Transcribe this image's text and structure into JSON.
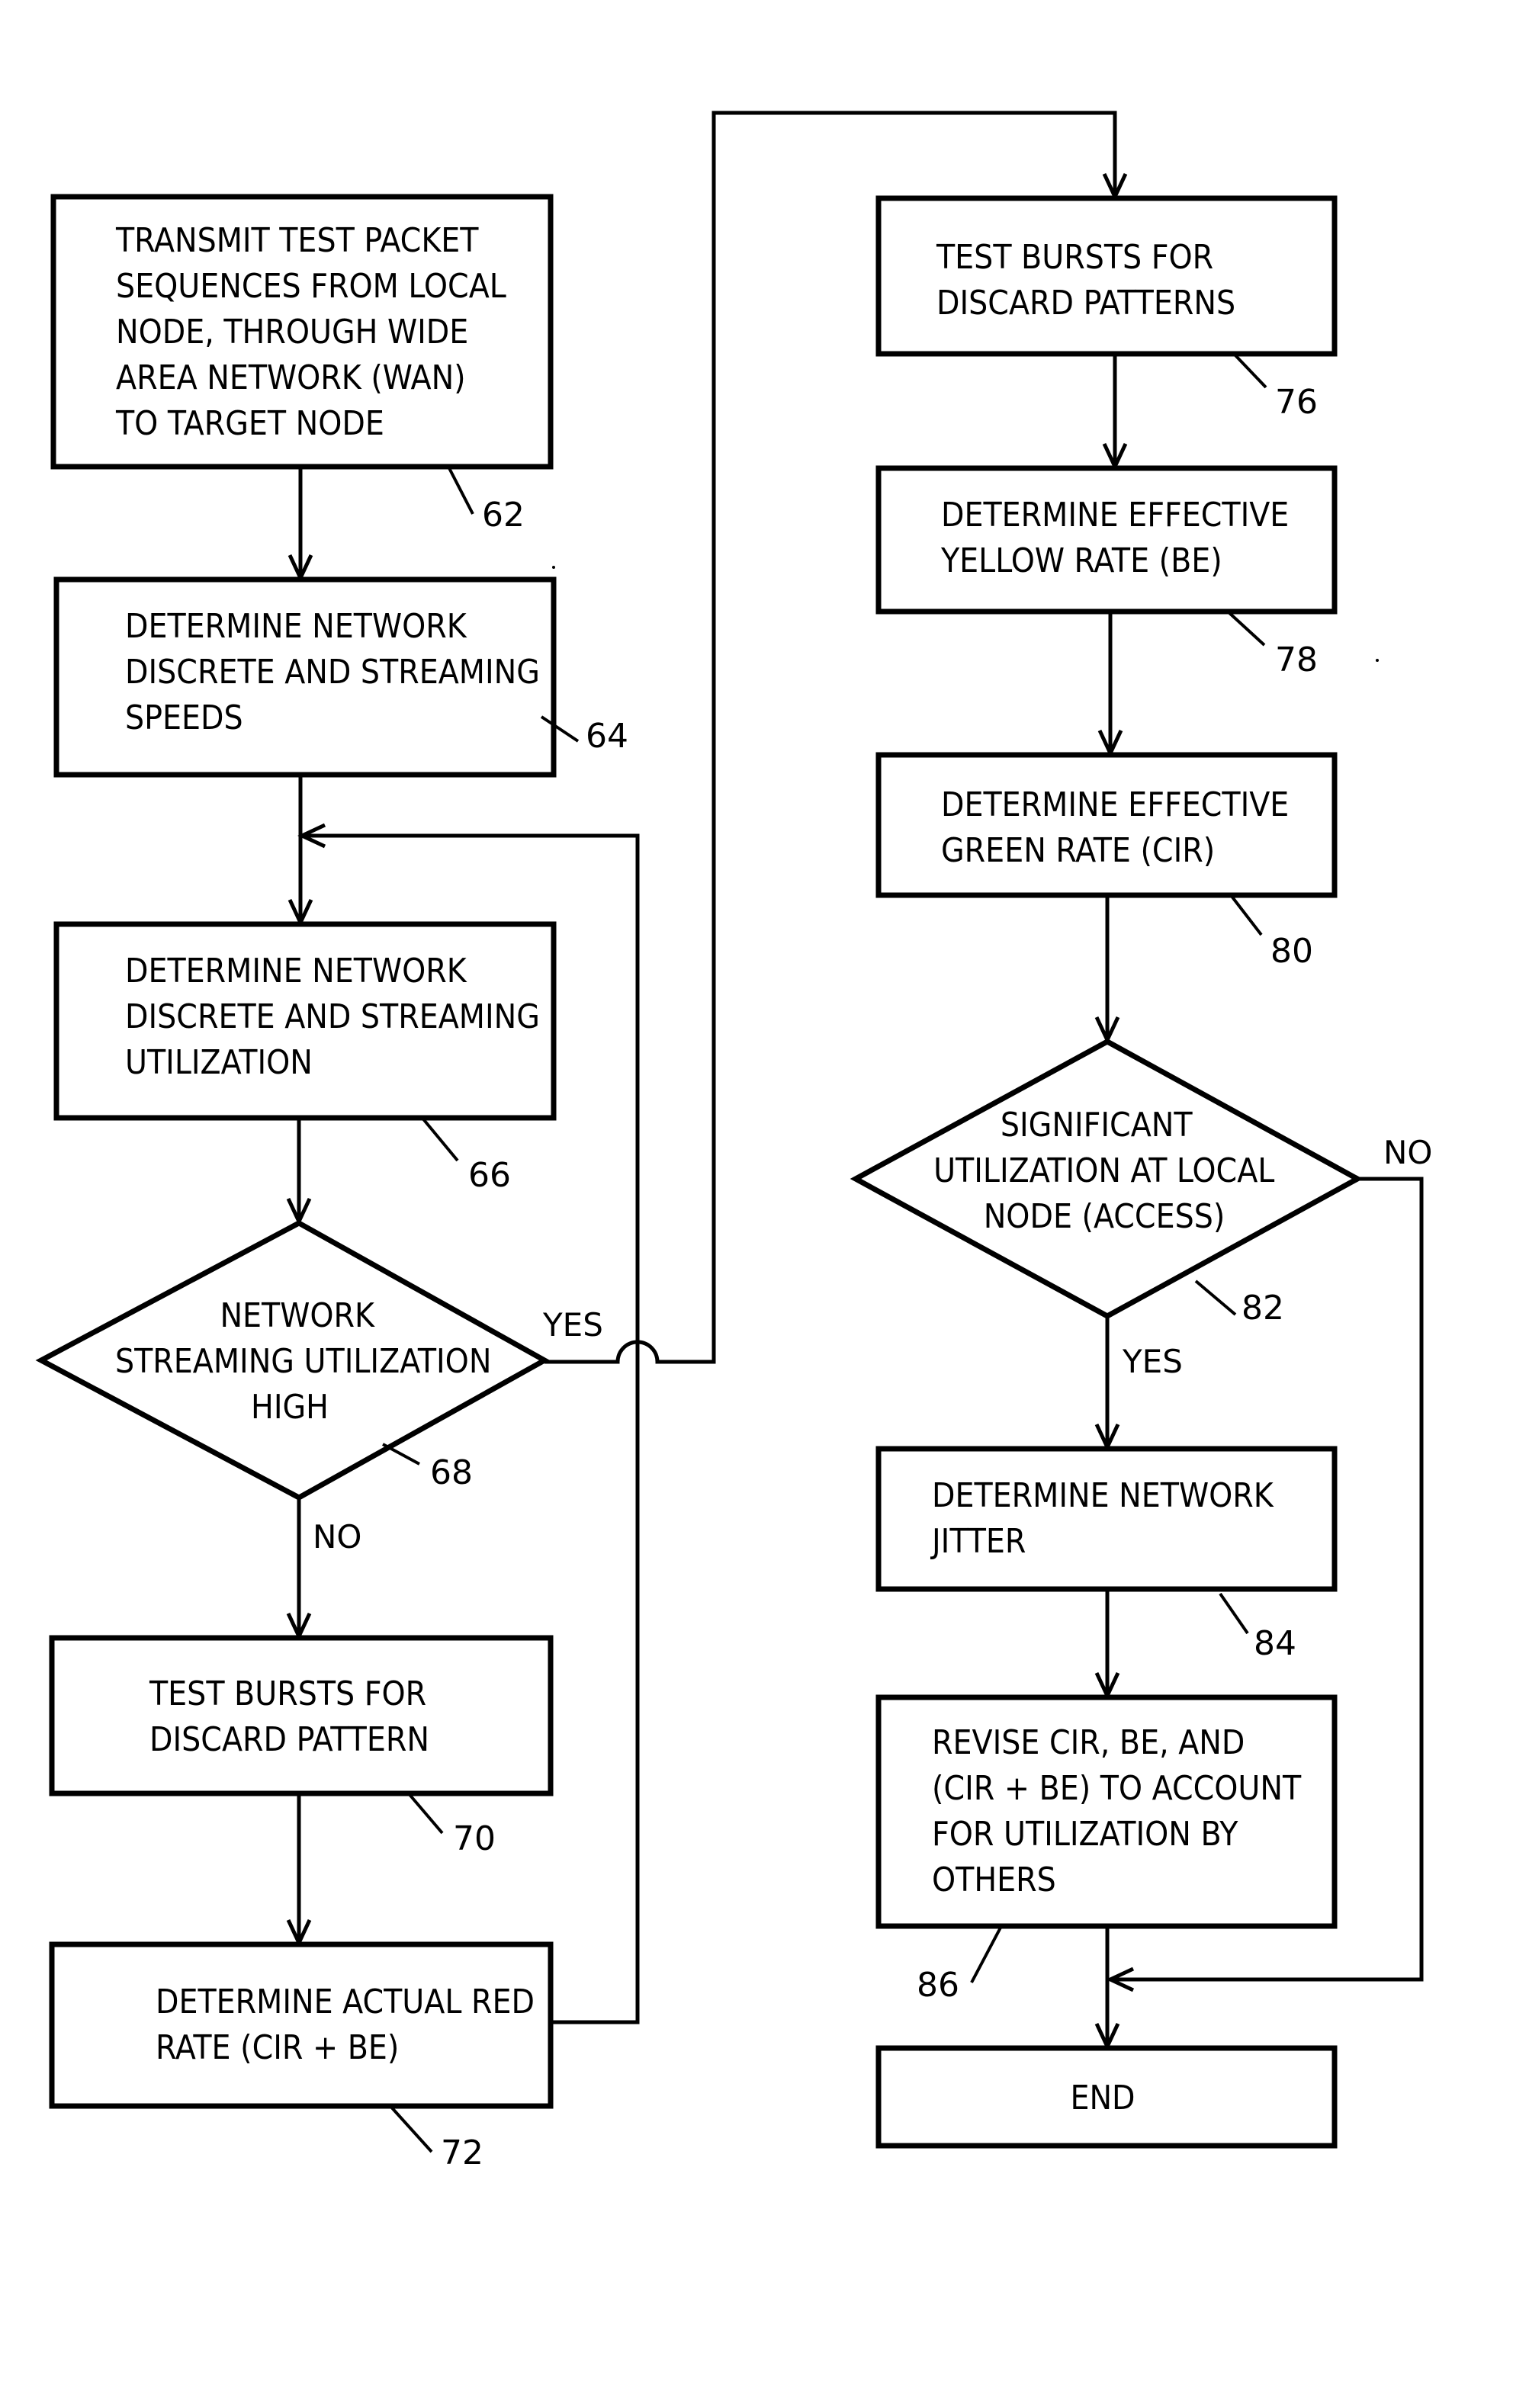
{
  "figure": {
    "type": "flowchart",
    "nodes": [
      {
        "id": "62",
        "shape": "process",
        "lines": [
          "TRANSMIT TEST PACKET",
          "SEQUENCES FROM LOCAL",
          "NODE, THROUGH WIDE",
          "AREA NETWORK (WAN)",
          "TO TARGET NODE"
        ],
        "ref": "62"
      },
      {
        "id": "64",
        "shape": "process",
        "lines": [
          "DETERMINE NETWORK",
          "DISCRETE AND STREAMING",
          "SPEEDS"
        ],
        "ref": "64"
      },
      {
        "id": "66",
        "shape": "process",
        "lines": [
          "DETERMINE NETWORK",
          "DISCRETE AND STREAMING",
          "UTILIZATION"
        ],
        "ref": "66"
      },
      {
        "id": "68",
        "shape": "decision",
        "lines": [
          "NETWORK",
          "STREAMING UTILIZATION",
          "HIGH"
        ],
        "ref": "68"
      },
      {
        "id": "70",
        "shape": "process",
        "lines": [
          "TEST BURSTS FOR",
          "DISCARD PATTERN"
        ],
        "ref": "70"
      },
      {
        "id": "72",
        "shape": "process",
        "lines": [
          "DETERMINE ACTUAL RED",
          "RATE (CIR + BE)"
        ],
        "ref": "72"
      },
      {
        "id": "76",
        "shape": "process",
        "lines": [
          "TEST BURSTS FOR",
          "DISCARD PATTERNS"
        ],
        "ref": "76"
      },
      {
        "id": "78",
        "shape": "process",
        "lines": [
          "DETERMINE EFFECTIVE",
          "YELLOW RATE (BE)"
        ],
        "ref": "78"
      },
      {
        "id": "80",
        "shape": "process",
        "lines": [
          "DETERMINE EFFECTIVE",
          "GREEN RATE (CIR)"
        ],
        "ref": "80"
      },
      {
        "id": "82",
        "shape": "decision",
        "lines": [
          "SIGNIFICANT",
          "UTILIZATION AT LOCAL",
          "NODE (ACCESS)"
        ],
        "ref": "82"
      },
      {
        "id": "84",
        "shape": "process",
        "lines": [
          "DETERMINE NETWORK",
          "JITTER"
        ],
        "ref": "84"
      },
      {
        "id": "86",
        "shape": "process",
        "lines": [
          "REVISE CIR, BE, AND",
          "(CIR + BE) TO ACCOUNT",
          "FOR UTILIZATION BY",
          "OTHERS"
        ],
        "ref": "86"
      },
      {
        "id": "end",
        "shape": "terminal",
        "lines": [
          "END"
        ],
        "ref": ""
      }
    ],
    "edges": [
      {
        "from": "62",
        "to": "64",
        "label": ""
      },
      {
        "from": "64",
        "to": "66",
        "label": ""
      },
      {
        "from": "66",
        "to": "68",
        "label": ""
      },
      {
        "from": "68",
        "to": "70",
        "label": "NO"
      },
      {
        "from": "68",
        "to": "76",
        "label": "YES"
      },
      {
        "from": "70",
        "to": "72",
        "label": ""
      },
      {
        "from": "72",
        "to": "66",
        "label": ""
      },
      {
        "from": "76",
        "to": "78",
        "label": ""
      },
      {
        "from": "78",
        "to": "80",
        "label": ""
      },
      {
        "from": "80",
        "to": "82",
        "label": ""
      },
      {
        "from": "82",
        "to": "84",
        "label": "YES"
      },
      {
        "from": "82",
        "to": "end",
        "label": "NO"
      },
      {
        "from": "84",
        "to": "86",
        "label": ""
      },
      {
        "from": "86",
        "to": "end",
        "label": ""
      }
    ],
    "edge_labels": {
      "d68_yes": "YES",
      "d68_no": "NO",
      "d82_yes": "YES",
      "d82_no": "NO"
    },
    "colors": {
      "ink": "#000000",
      "paper": "#ffffff"
    }
  }
}
